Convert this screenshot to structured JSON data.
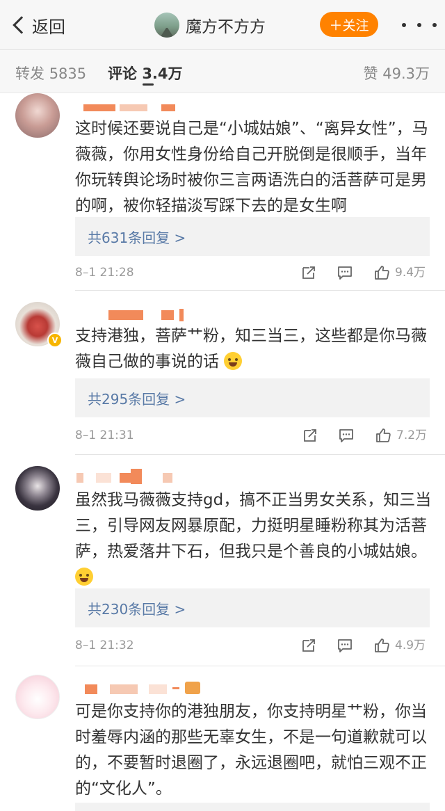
{
  "nav": {
    "back_label": "返回",
    "profile_name": "魔方不方方",
    "follow_label": "＋关注"
  },
  "stats": {
    "repost_label": "转发",
    "repost_count": "5835",
    "comment_label": "评论",
    "comment_count": "3.4万",
    "like_label": "赞",
    "like_count": "49.3万"
  },
  "comments": [
    {
      "text": "这时候还要说自己是“小城姑娘”、“离异女性”，马薇薇，你用女性身份给自己开脱倒是很顺手，当年你玩转舆论场时被你三言两语洗白的活菩萨可是男的啊，被你轻描淡写踩下去的是女生啊",
      "replies": "共631条回复 >",
      "time": "8–1 21:28",
      "likes": "9.4万"
    },
    {
      "text": "支持港独，菩萨艹粉，知三当三，这些都是你马薇薇自己做的事说的话",
      "replies": "共295条回复 >",
      "time": "8–1 21:31",
      "likes": "7.2万"
    },
    {
      "text": "虽然我马薇薇支持gd，搞不正当男女关系，知三当三，引导网友网暴原配，力挺明星睡粉称其为活菩萨，热爱落井下石，但我只是个善良的小城姑娘。",
      "replies": "共230条回复 >",
      "time": "8–1 21:32",
      "likes": "4.9万"
    },
    {
      "text": "可是你支持你的港独朋友，你支持明星艹粉，你当时羞辱内涵的那些无辜女生，不是一句道歉就可以的，不要暂时退圈了，永远退圈吧，就怕三观不正的“文化人”。"
    }
  ],
  "colors": {
    "accent": "#ff8200",
    "link": "#5879a6",
    "reply_bg": "#f2f2f2",
    "badge": "#f7b500"
  },
  "icons": [
    "back-chevron-icon",
    "more-dots-icon",
    "share-icon",
    "comment-icon",
    "thumbs-up-icon",
    "verified-badge-icon",
    "emoji-icon"
  ]
}
